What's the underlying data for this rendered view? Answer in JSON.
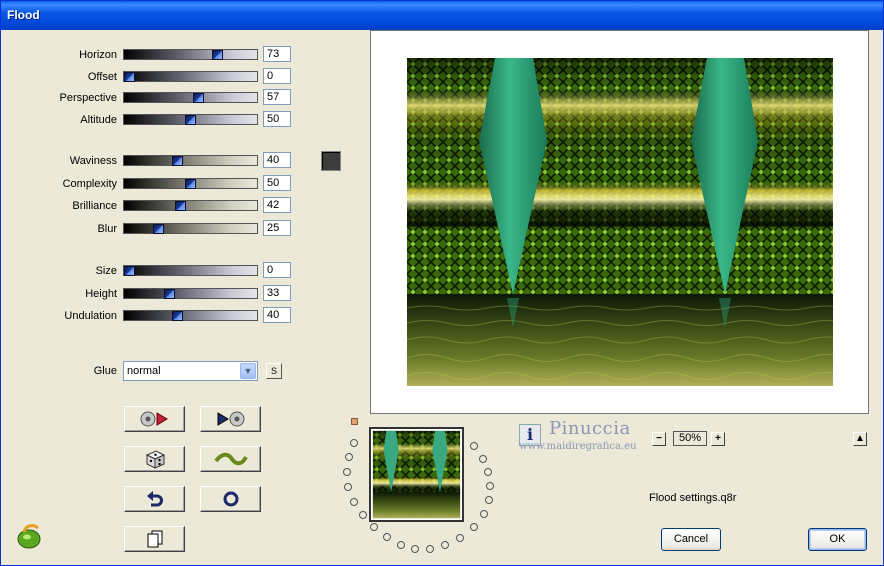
{
  "window": {
    "title": "Flood"
  },
  "groups": [
    {
      "rows": [
        {
          "label": "Horizon",
          "value": 73,
          "display": "73"
        },
        {
          "label": "Offset",
          "value": 0,
          "display": "0"
        },
        {
          "label": "Perspective",
          "value": 57,
          "display": "57"
        },
        {
          "label": "Altitude",
          "value": 50,
          "display": "50"
        }
      ]
    },
    {
      "rows": [
        {
          "label": "Waviness",
          "value": 40,
          "display": "40"
        },
        {
          "label": "Complexity",
          "value": 50,
          "display": "50"
        },
        {
          "label": "Brilliance",
          "value": 42,
          "display": "42"
        },
        {
          "label": "Blur",
          "value": 25,
          "display": "25"
        }
      ]
    },
    {
      "rows": [
        {
          "label": "Size",
          "value": 0,
          "display": "0"
        },
        {
          "label": "Height",
          "value": 33,
          "display": "33"
        },
        {
          "label": "Undulation",
          "value": 40,
          "display": "40"
        }
      ]
    }
  ],
  "glue": {
    "label": "Glue",
    "value": "normal",
    "s_label": "S"
  },
  "color_swatch": "#3c3c3c",
  "tools": [
    "prev-preset-icon",
    "next-preset-icon",
    "randomize-dice-icon",
    "wave-icon",
    "undo-icon",
    "reset-icon",
    "copy-icon"
  ],
  "preview": {
    "zoom": "50%",
    "zoom_minus": "−",
    "zoom_plus": "+"
  },
  "watermark": {
    "name": "Pinuccia",
    "url": "www.maidiregrafica.eu"
  },
  "settings_file": "Flood settings.q8r",
  "buttons": {
    "cancel": "Cancel",
    "ok": "OK"
  },
  "colors": {
    "title_bar": "#0a56e6",
    "dialog_bg": "#ece9d8",
    "teal_spike": "#2a9a72",
    "green_pattern": "#4a8a10",
    "gold_band": "#e8d040"
  }
}
